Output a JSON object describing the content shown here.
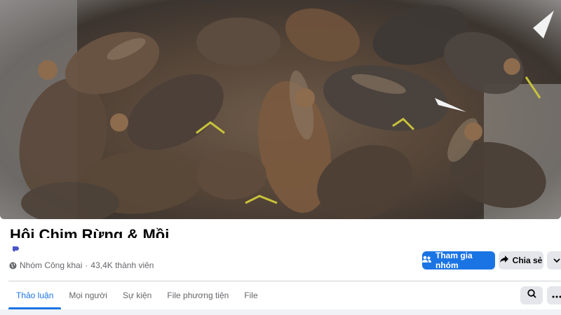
{
  "cover": {
    "description_icon": "cover-photo"
  },
  "group": {
    "name": "Hội Chim Rừng & Mồi",
    "privacy": "Nhóm Công khai",
    "separator": "·",
    "members": "43,4K thành viên"
  },
  "actions": {
    "join_label": "Tham gia nhóm",
    "share_label": "Chia sẻ"
  },
  "tabs": [
    {
      "label": "Thảo luận",
      "active": true
    },
    {
      "label": "Mọi người",
      "active": false
    },
    {
      "label": "Sự kiện",
      "active": false
    },
    {
      "label": "File phương tiện",
      "active": false
    },
    {
      "label": "File",
      "active": false
    }
  ],
  "colors": {
    "accent": "#1b74e4",
    "button_gray": "#e4e6eb",
    "meta_text": "#65676b"
  }
}
